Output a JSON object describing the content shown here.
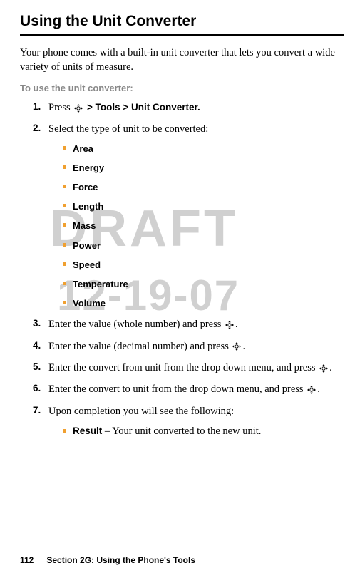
{
  "title": "Using the Unit Converter",
  "intro": "Your phone comes with a built-in unit converter that lets you convert a wide variety of units of measure.",
  "subhead": "To use the unit converter:",
  "watermark1": "DRAFT",
  "watermark2": "12-19-07",
  "steps": {
    "s1": {
      "num": "1.",
      "pre": "Press ",
      "post": " > Tools > Unit Converter."
    },
    "s2": {
      "num": "2.",
      "text": "Select the type of unit to be converted:"
    },
    "s3": {
      "num": "3.",
      "pre": "Enter the value (whole number) and press ",
      "post": "."
    },
    "s4": {
      "num": "4.",
      "pre": "Enter the value (decimal number) and press ",
      "post": "."
    },
    "s5": {
      "num": "5.",
      "pre": "Enter the convert from unit from the drop down menu, and press ",
      "post": "."
    },
    "s6": {
      "num": "6.",
      "pre": "Enter the convert to unit from the drop down menu, and press ",
      "post": "."
    },
    "s7": {
      "num": "7.",
      "text": "Upon completion you will see the following:"
    }
  },
  "unit_types": [
    "Area",
    "Energy",
    "Force",
    "Length",
    "Mass",
    "Power",
    "Speed",
    "Temperature",
    "Volume"
  ],
  "result": {
    "label": "Result",
    "desc": " – Your unit converted to the new unit."
  },
  "footer": {
    "page": "112",
    "section": "Section 2G: Using the Phone's Tools"
  }
}
